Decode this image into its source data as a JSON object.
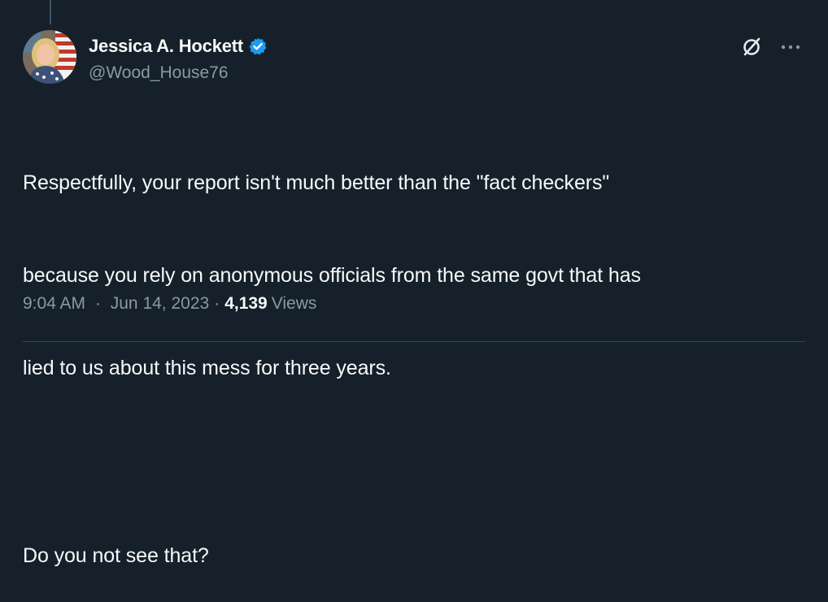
{
  "author": {
    "display_name": "Jessica A. Hockett",
    "handle": "@Wood_House76",
    "verified": true,
    "verified_color": "#1d9bf0"
  },
  "actions": {
    "grok_icon": "slashed-circle-icon",
    "more_icon": "more-dots-icon"
  },
  "tweet": {
    "lines": [
      "Respectfully, your report isn't much better than the \"fact checkers\"",
      "because you rely on anonymous officials from the same govt that has",
      "lied to us about this mess for three years.",
      "Do you not see that?"
    ]
  },
  "meta": {
    "time": "9:04 AM",
    "separator": "·",
    "date": "Jun 14, 2023",
    "views_count": "4,139",
    "views_label": "Views"
  },
  "colors": {
    "background": "#15202b",
    "primary_text": "#f7f9f9",
    "secondary_text": "#8b98a5"
  }
}
